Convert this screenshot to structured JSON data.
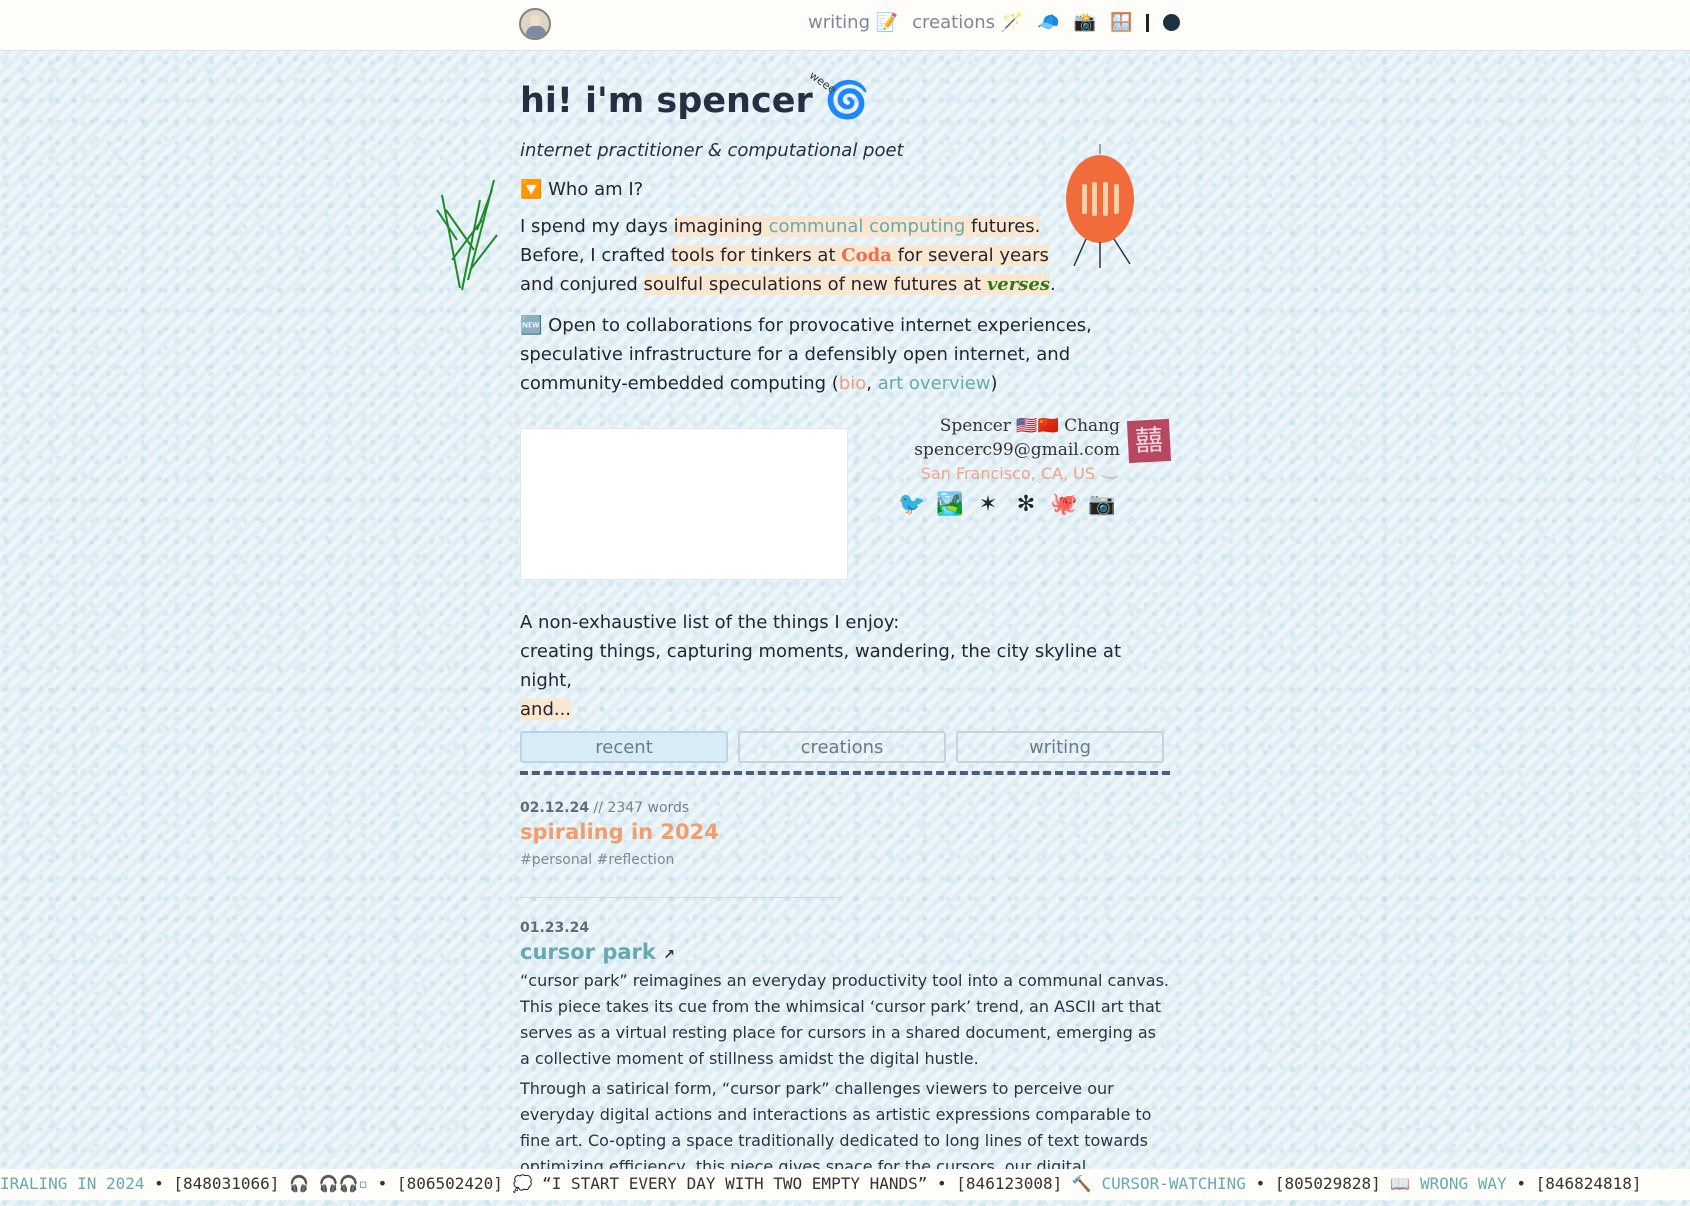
{
  "nav": {
    "items": [
      {
        "label": "writing 📝"
      },
      {
        "label": "creations 🪄"
      },
      {
        "label": "🧢"
      },
      {
        "label": "📸"
      },
      {
        "label": "🪟"
      }
    ]
  },
  "hero": {
    "title": "hi! i'm spencer",
    "spiral": "🌀",
    "weee": "weee",
    "subtitle": "internet practitioner & computational poet",
    "who": "🔽 Who am I?"
  },
  "intro": {
    "p1a": "I spend my days ",
    "p1b": "imagining ",
    "p1c": "communal computing",
    "p1d": " futures.",
    "p2a": "Before, I crafted ",
    "p2b": "tools for tinkers at ",
    "p2c": "Coda",
    "p2d": " for several years",
    "p3a": "and conjured ",
    "p3b": "soulful speculations of new futures at ",
    "p3c": "verses",
    "p3d": "."
  },
  "open": {
    "text": "🆕 Open to collaborations for provocative internet experiences, speculative infrastructure for a defensibly open internet, and community-embedded computing (",
    "bio": "bio",
    "comma": ", ",
    "art": "art overview",
    "close": ")"
  },
  "contact": {
    "name": "Spencer 🇺🇸🇨🇳 Chang",
    "email": "spencerc99@gmail.com",
    "location": "San Francisco, CA, US ☁️",
    "stamp": "囍"
  },
  "socials": [
    {
      "name": "twitter",
      "glyph": "🐦"
    },
    {
      "name": "mastodon",
      "glyph": "🏞️"
    },
    {
      "name": "bluesky",
      "glyph": "✶"
    },
    {
      "name": "are-na",
      "glyph": "✻"
    },
    {
      "name": "github",
      "glyph": "🐙"
    },
    {
      "name": "instagram",
      "glyph": "📷"
    }
  ],
  "enjoy": {
    "line1": "A non-exhaustive list of the things I enjoy:",
    "line2": "creating things, capturing moments, wandering, the city skyline at night,",
    "line3": "and..."
  },
  "tabs": [
    {
      "label": "recent",
      "active": true
    },
    {
      "label": "creations"
    },
    {
      "label": "writing"
    }
  ],
  "posts": [
    {
      "date": "02.12.24",
      "words": "// 2347 words",
      "title": "spiraling in 2024",
      "tags": "#personal #reflection",
      "color": "#f29d6a"
    },
    {
      "date": "01.23.24",
      "title": "cursor park",
      "color": "#65aab0",
      "p1": "“cursor park” reimagines an everyday productivity tool into a communal canvas. This piece takes its cue from the whimsical ‘cursor park’ trend, an ASCII art that serves as a virtual resting place for cursors in a shared document, emerging as a collective moment of stillness amidst the digital hustle.",
      "p2": "Through a satirical form, “cursor park” challenges viewers to perceive our everyday digital actions and interactions as artistic expressions comparable to fine art. Co-opting a space traditionally dedicated to long lines of text towards optimizing efficiency, this piece gives space for the cursors, our digital embodiments, to become"
    }
  ],
  "ticker": {
    "a": "IRALING IN 2024",
    "b": " • [848031066] 🎧 ",
    "c": "🎧🎧▫",
    "d": " • [806502420] 💭 “I START EVERY DAY WITH TWO EMPTY HANDS” • [846123008] 🔨 ",
    "e": "CURSOR-WATCHING",
    "f": " • [805029828] 📖 ",
    "g": "WRONG WAY",
    "h": " • [846824818]"
  }
}
